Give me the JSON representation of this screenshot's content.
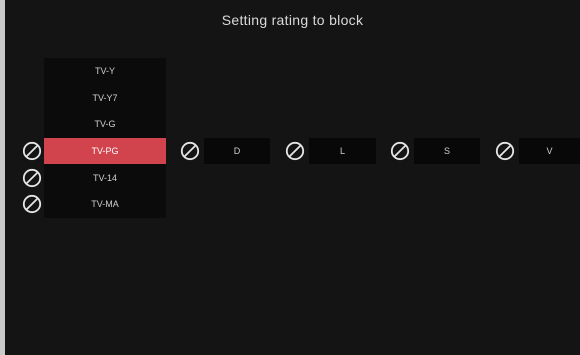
{
  "header": {
    "title": "Setting rating to block"
  },
  "ratings": {
    "items": [
      {
        "label": "TV-Y",
        "blocked": false,
        "selected": false
      },
      {
        "label": "TV-Y7",
        "blocked": false,
        "selected": false
      },
      {
        "label": "TV-G",
        "blocked": false,
        "selected": false
      },
      {
        "label": "TV-PG",
        "blocked": true,
        "selected": true
      },
      {
        "label": "TV-14",
        "blocked": true,
        "selected": false
      },
      {
        "label": "TV-MA",
        "blocked": true,
        "selected": false
      }
    ]
  },
  "content_flags": {
    "items": [
      {
        "label": "D",
        "blocked": true
      },
      {
        "label": "L",
        "blocked": true
      },
      {
        "label": "S",
        "blocked": true
      },
      {
        "label": "V",
        "blocked": true
      }
    ]
  },
  "colors": {
    "background": "#141414",
    "list_background": "#0b0b0b",
    "selected": "#d1444d",
    "text": "#d9d9d9"
  },
  "icons": {
    "block": "block-icon"
  }
}
